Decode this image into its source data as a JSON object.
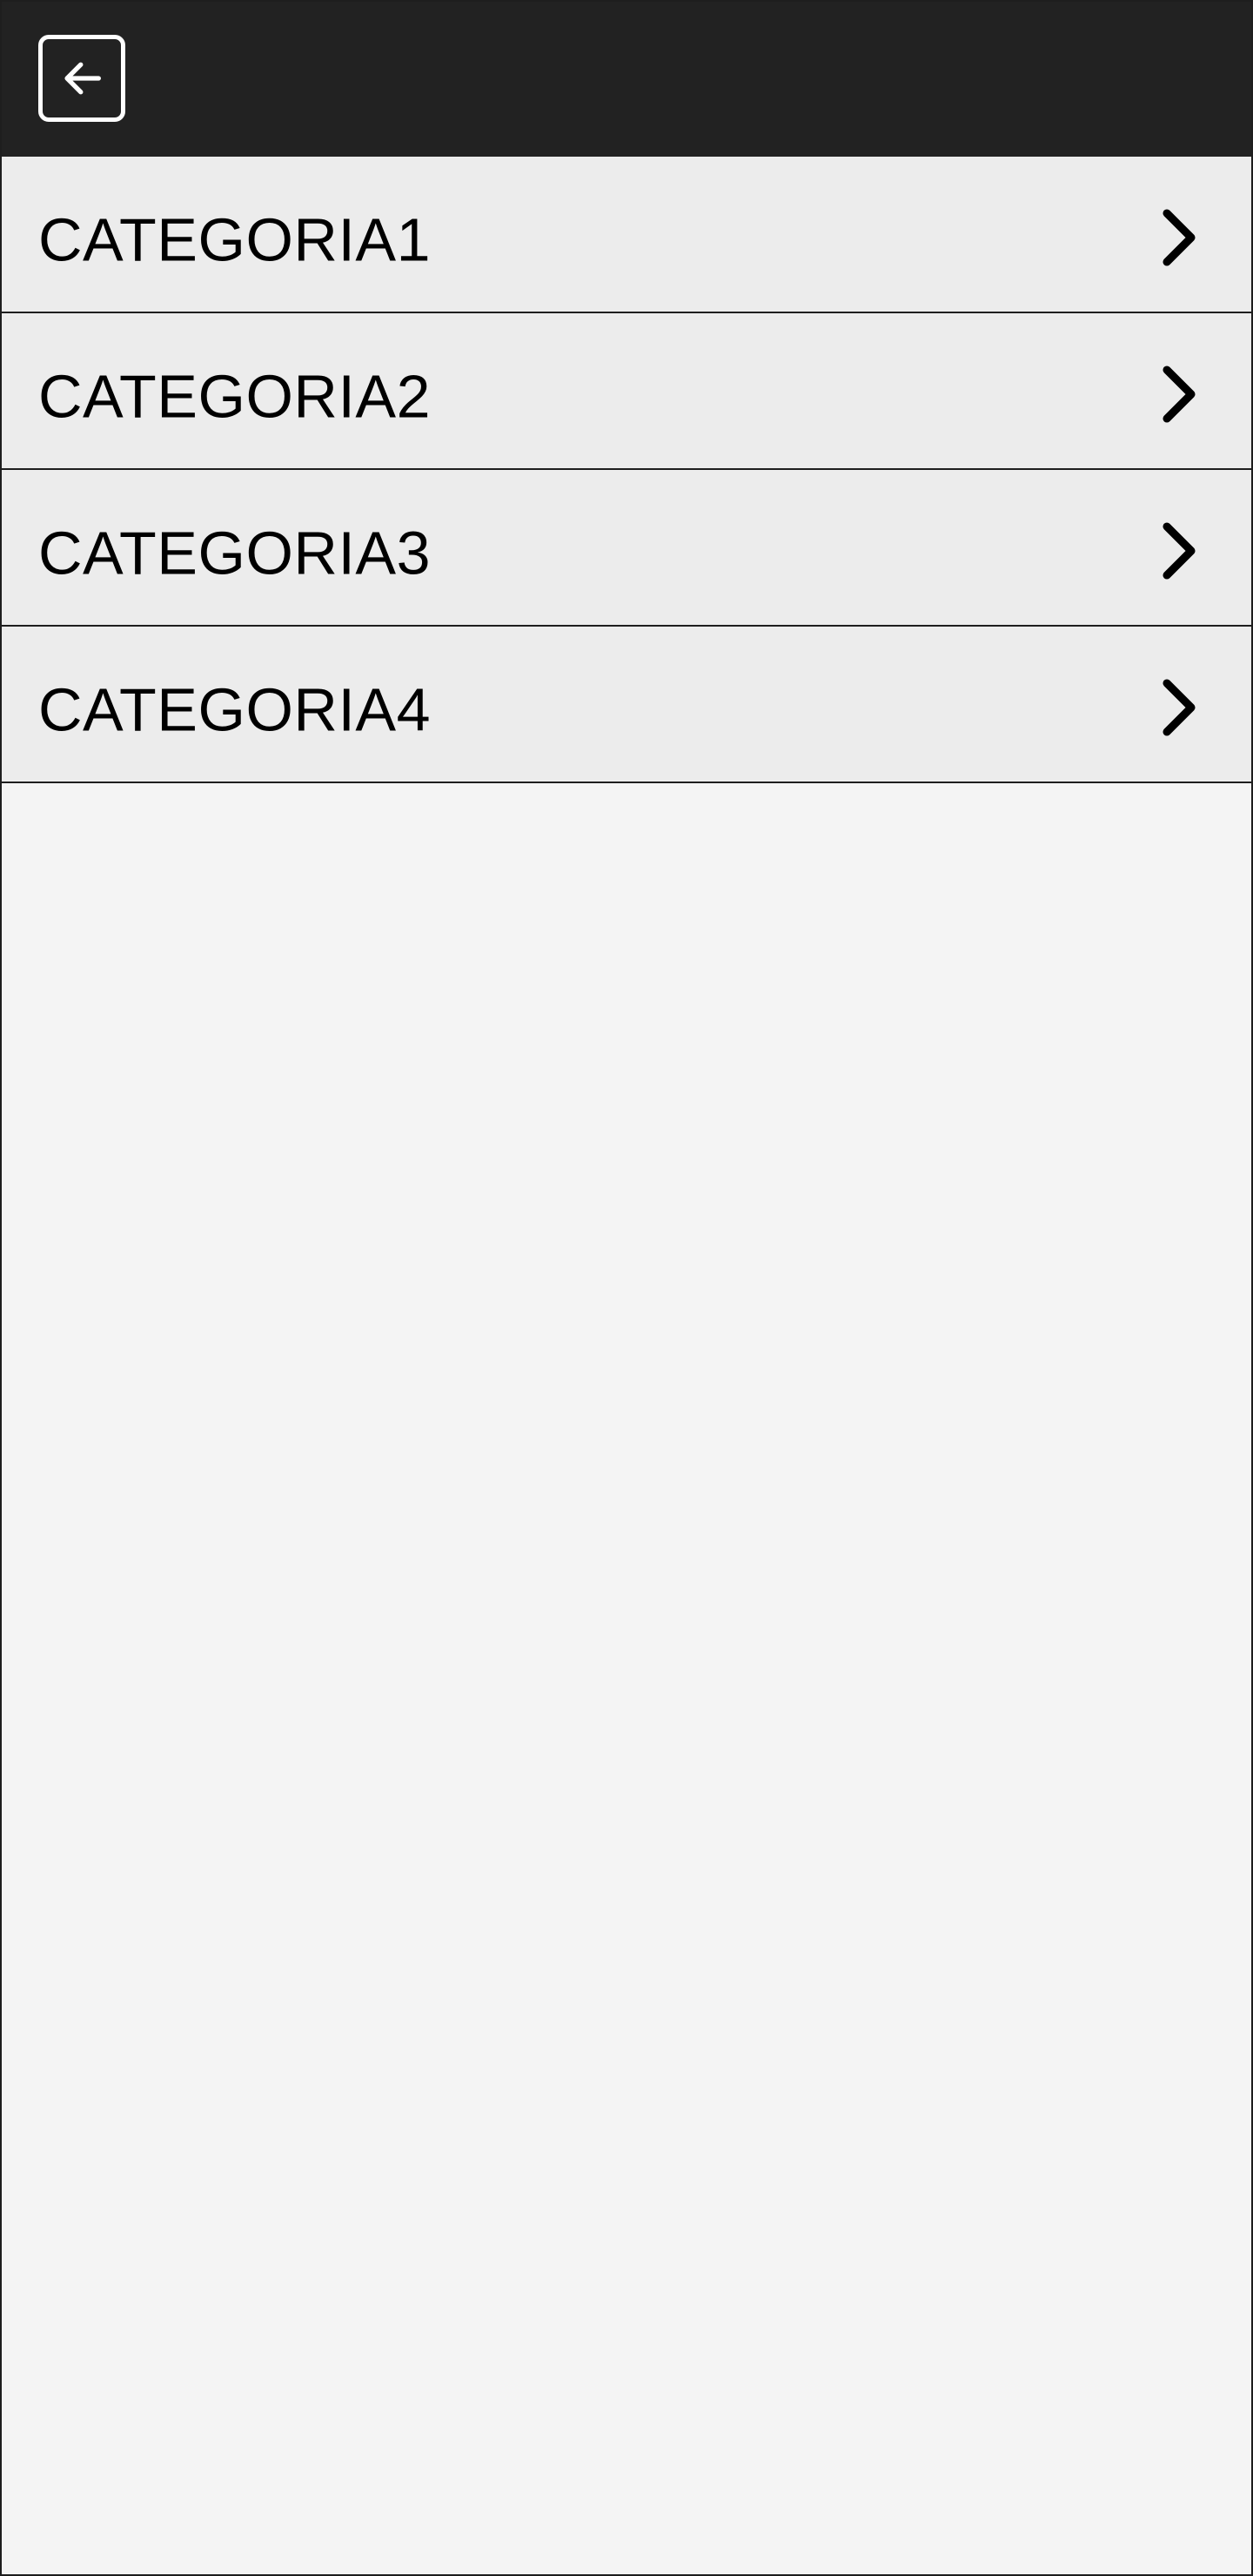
{
  "header": {
    "back_icon": "arrow-left-icon",
    "background": "#222222"
  },
  "categories": [
    {
      "label": "CATEGORIA1",
      "icon": "chevron-right-icon"
    },
    {
      "label": "CATEGORIA2",
      "icon": "chevron-right-icon"
    },
    {
      "label": "CATEGORIA3",
      "icon": "chevron-right-icon"
    },
    {
      "label": "CATEGORIA4",
      "icon": "chevron-right-icon"
    }
  ],
  "colors": {
    "item_background": "#ececec",
    "page_background": "#f4f4f4",
    "divider": "#1e1e1e",
    "text": "#000000"
  }
}
